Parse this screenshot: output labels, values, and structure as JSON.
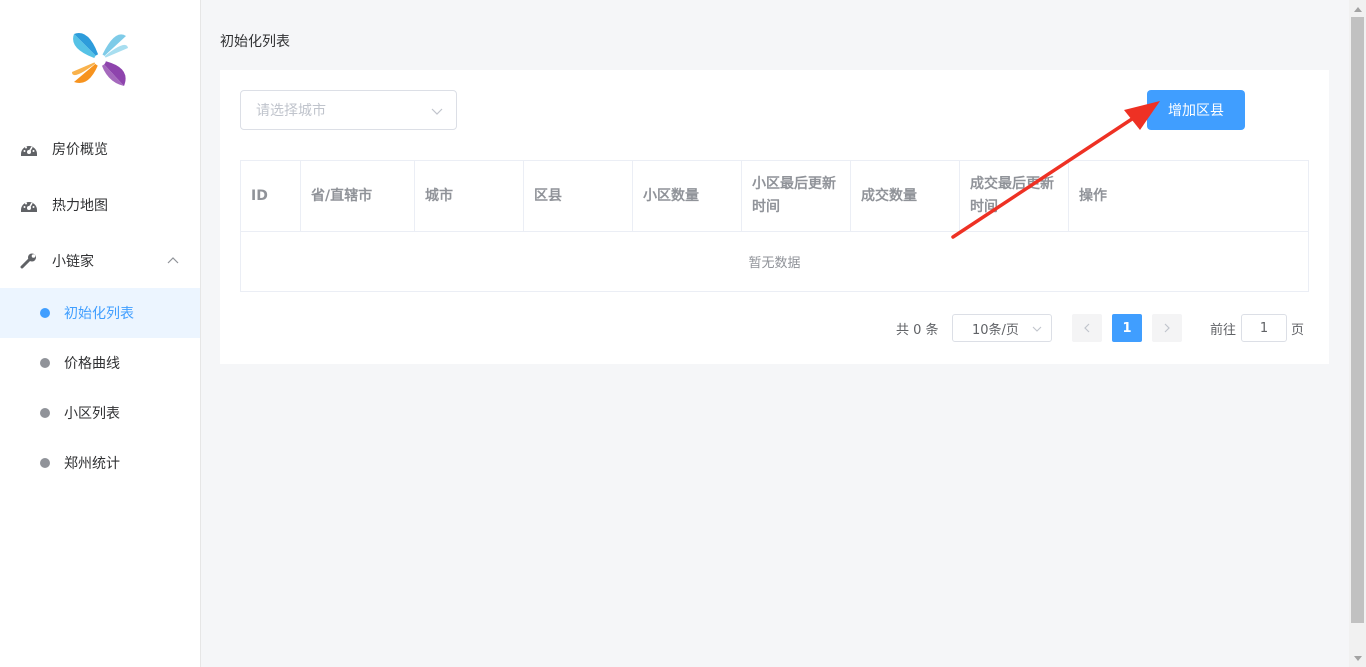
{
  "sidebar": {
    "logo": "pinwheel-logo",
    "menu": [
      {
        "label": "房价概览",
        "icon": "dashboard-icon"
      },
      {
        "label": "热力地图",
        "icon": "dashboard-icon"
      },
      {
        "label": "小链家",
        "icon": "wrench-icon",
        "expanded": true
      }
    ],
    "submenu": [
      {
        "label": "初始化列表",
        "active": true
      },
      {
        "label": "价格曲线",
        "active": false
      },
      {
        "label": "小区列表",
        "active": false
      },
      {
        "label": "郑州统计",
        "active": false
      }
    ]
  },
  "breadcrumb": "初始化列表",
  "filter": {
    "city_placeholder": "请选择城市"
  },
  "actions": {
    "add_district": "增加区县"
  },
  "table": {
    "columns": [
      "ID",
      "省/直辖市",
      "城市",
      "区县",
      "小区数量",
      "小区最后更新时间",
      "成交数量",
      "成交最后更新时间",
      "操作"
    ],
    "empty_text": "暂无数据"
  },
  "pagination": {
    "total": "共 0 条",
    "page_size": "10条/页",
    "current_page": "1",
    "goto_label": "前往",
    "goto_value": "1",
    "page_unit": "页"
  },
  "colors": {
    "primary": "#409eff",
    "arrow": "#ee3124"
  }
}
